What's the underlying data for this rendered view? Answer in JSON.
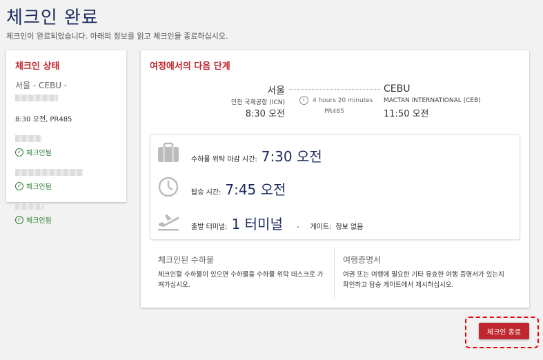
{
  "page": {
    "title": "체크인 완료",
    "subtitle": "체크인이 완료되었습니다. 아래의 정보를 읽고 체크인을 종료하십시오."
  },
  "status_card": {
    "heading": "체크인 상태",
    "route": "서울 - CEBU -",
    "flight_info": "8:30 오전, PR485",
    "passengers": [
      {
        "status": "체크인됨"
      },
      {
        "status": "체크인됨"
      },
      {
        "status": "체크인됨"
      }
    ]
  },
  "next_steps": {
    "heading": "여정에서의 다음 단계",
    "origin": {
      "city": "서울",
      "airport": "인천 국제공항 (ICN)",
      "time": "8:30 오전"
    },
    "duration": "4 hours 20 minutes",
    "flight_number": "PR485",
    "destination": {
      "city": "CEBU",
      "airport": "MACTAN INTERNATIONAL (CEB)",
      "time": "11:50 오전"
    },
    "baggage_deadline": {
      "label": "수하물 위탁 마감 시간:",
      "value": "7:30 오전"
    },
    "boarding": {
      "label": "탑승 시간:",
      "value": "7:45 오전"
    },
    "terminal": {
      "label": "출발 터미널:",
      "value": "1 터미널",
      "separator": "-",
      "gate_label": "게이트:",
      "gate_value": "정보 없음"
    },
    "checked_baggage": {
      "title": "체크인된 수하물",
      "text": "체크인할 수하물이 있으면 수하물을 수하물 위탁 데스크로 가져가십시오."
    },
    "travel_documents": {
      "title": "여행증명서",
      "text": "여권 또는 여행에 필요한 기타 유효한 여행 증명서가 있는지 확인하고 탑승 게이트에서 제시하십시오."
    }
  },
  "actions": {
    "finish_label": "체크인 종료"
  },
  "colors": {
    "accent": "#c0262d",
    "title": "#1b2a5e",
    "success": "#2e7d32"
  }
}
